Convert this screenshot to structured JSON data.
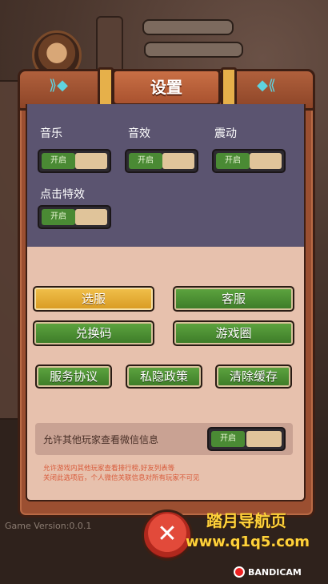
{
  "dialog": {
    "title": "设置"
  },
  "sound": {
    "music_label": "音乐",
    "sfx_label": "音效",
    "vibrate_label": "震动",
    "click_fx_label": "点击特效",
    "toggle_on_text": "开启"
  },
  "buttons": {
    "server_select": "选服",
    "customer_service": "客服",
    "redeem_code": "兑换码",
    "game_circle": "游戏圈",
    "service_agreement": "服务协议",
    "privacy_policy": "私隐政策",
    "clear_cache": "清除缓存"
  },
  "wechat": {
    "label": "允许其他玩家查看微信信息",
    "toggle_text": "开启",
    "note_line1": "允许游戏内其他玩家查看排行榜,好友列表等",
    "note_line2": "关闭此选项后，个人微信关联信息对所有玩家不可见"
  },
  "footer": {
    "version": "Game Version:0.0.1",
    "watermark_line1": "踏月导航页",
    "watermark_line2": "www.q1q5.com",
    "recorder": "BANDICAM"
  },
  "colors": {
    "frame": "#9b4f31",
    "dark_panel": "#5b5470",
    "light_panel": "#e7c1ad",
    "button_green": "#4a8f32",
    "button_yellow": "#e6ae35",
    "toggle_on": "#4a8a34",
    "close_red": "#d83a2c"
  }
}
